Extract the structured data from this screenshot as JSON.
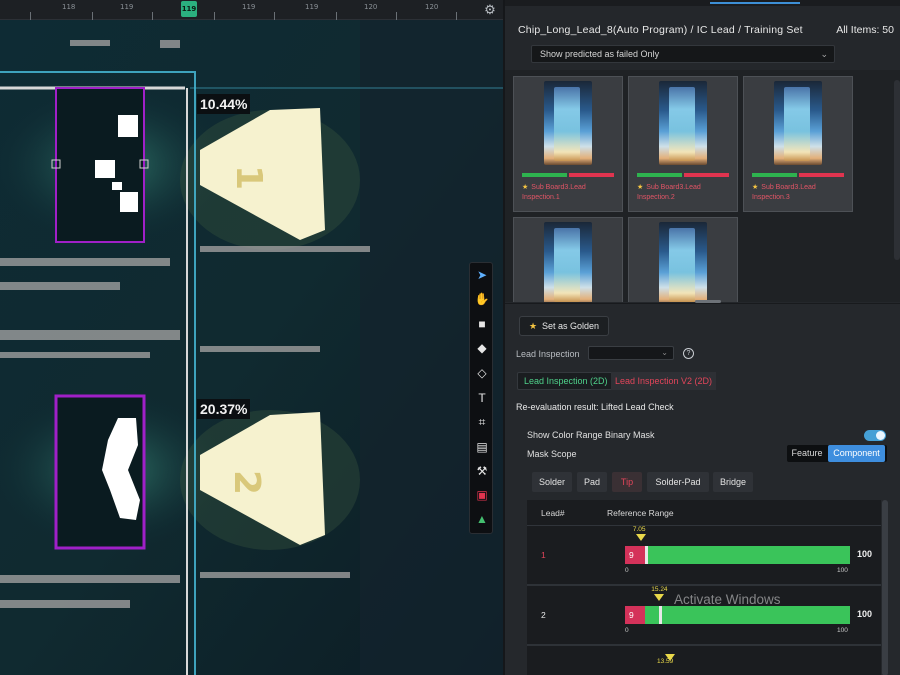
{
  "ruler": {
    "ticks": [
      "118",
      "118",
      "119",
      "119",
      "119",
      "119",
      "120",
      "120"
    ],
    "cursor": "119"
  },
  "viewer": {
    "overlays": [
      {
        "label": "10.44%",
        "digit": "1"
      },
      {
        "label": "20.37%",
        "digit": "2"
      }
    ]
  },
  "toolbar": {
    "tools": [
      "pointer-icon",
      "hand-icon",
      "solid-3d-icon",
      "cube-icon",
      "box-outline-icon",
      "text-icon",
      "scan-icon",
      "chat-icon",
      "robot-arm-icon",
      "red-square-icon",
      "triangle-icon"
    ]
  },
  "panel": {
    "breadcrumb": "Chip_Long_Lead_8(Auto Program) / IC Lead / Training Set",
    "all_items": "All Items:  50",
    "filter": "Show predicted as failed Only"
  },
  "thumbnails": [
    {
      "caption": "Sub Board3.Lead Inspection.1"
    },
    {
      "caption": "Sub Board3.Lead Inspection.2"
    },
    {
      "caption": "Sub Board3.Lead Inspection.3"
    },
    {
      "caption": ""
    },
    {
      "caption": ""
    }
  ],
  "controls": {
    "set_golden": "Set as Golden",
    "lead_inspection_label": "Lead Inspection",
    "tab_a": "Lead Inspection (2D)",
    "tab_b": "Lead Inspection V2 (2D)",
    "reeval": "Re-evaluation result: Lifted Lead Check",
    "show_mask": "Show Color Range Binary Mask",
    "mask_scope": "Mask Scope",
    "scope_feature": "Feature",
    "scope_component": "Component",
    "content_tabs": [
      "Solder",
      "Pad",
      "Tip",
      "Solder-Pad",
      "Bridge"
    ]
  },
  "table": {
    "col_lead": "Lead#",
    "col_range": "Reference Range",
    "rows": [
      {
        "lead": "1",
        "min": "9",
        "max": "100",
        "lo": "0",
        "hi": "100",
        "marker": "7.05",
        "marker_value": 7.05,
        "min_value": 9
      },
      {
        "lead": "2",
        "min": "9",
        "max": "100",
        "lo": "0",
        "hi": "100",
        "marker": "15.24",
        "marker_value": 15.24,
        "min_value": 9
      }
    ],
    "next_marker": "13.59"
  },
  "watermark": "Activate Windows",
  "colors": {
    "accent": "#3e8ede",
    "pass": "#3ac45a",
    "fail": "#d4325a",
    "selection": "#a020c8"
  }
}
